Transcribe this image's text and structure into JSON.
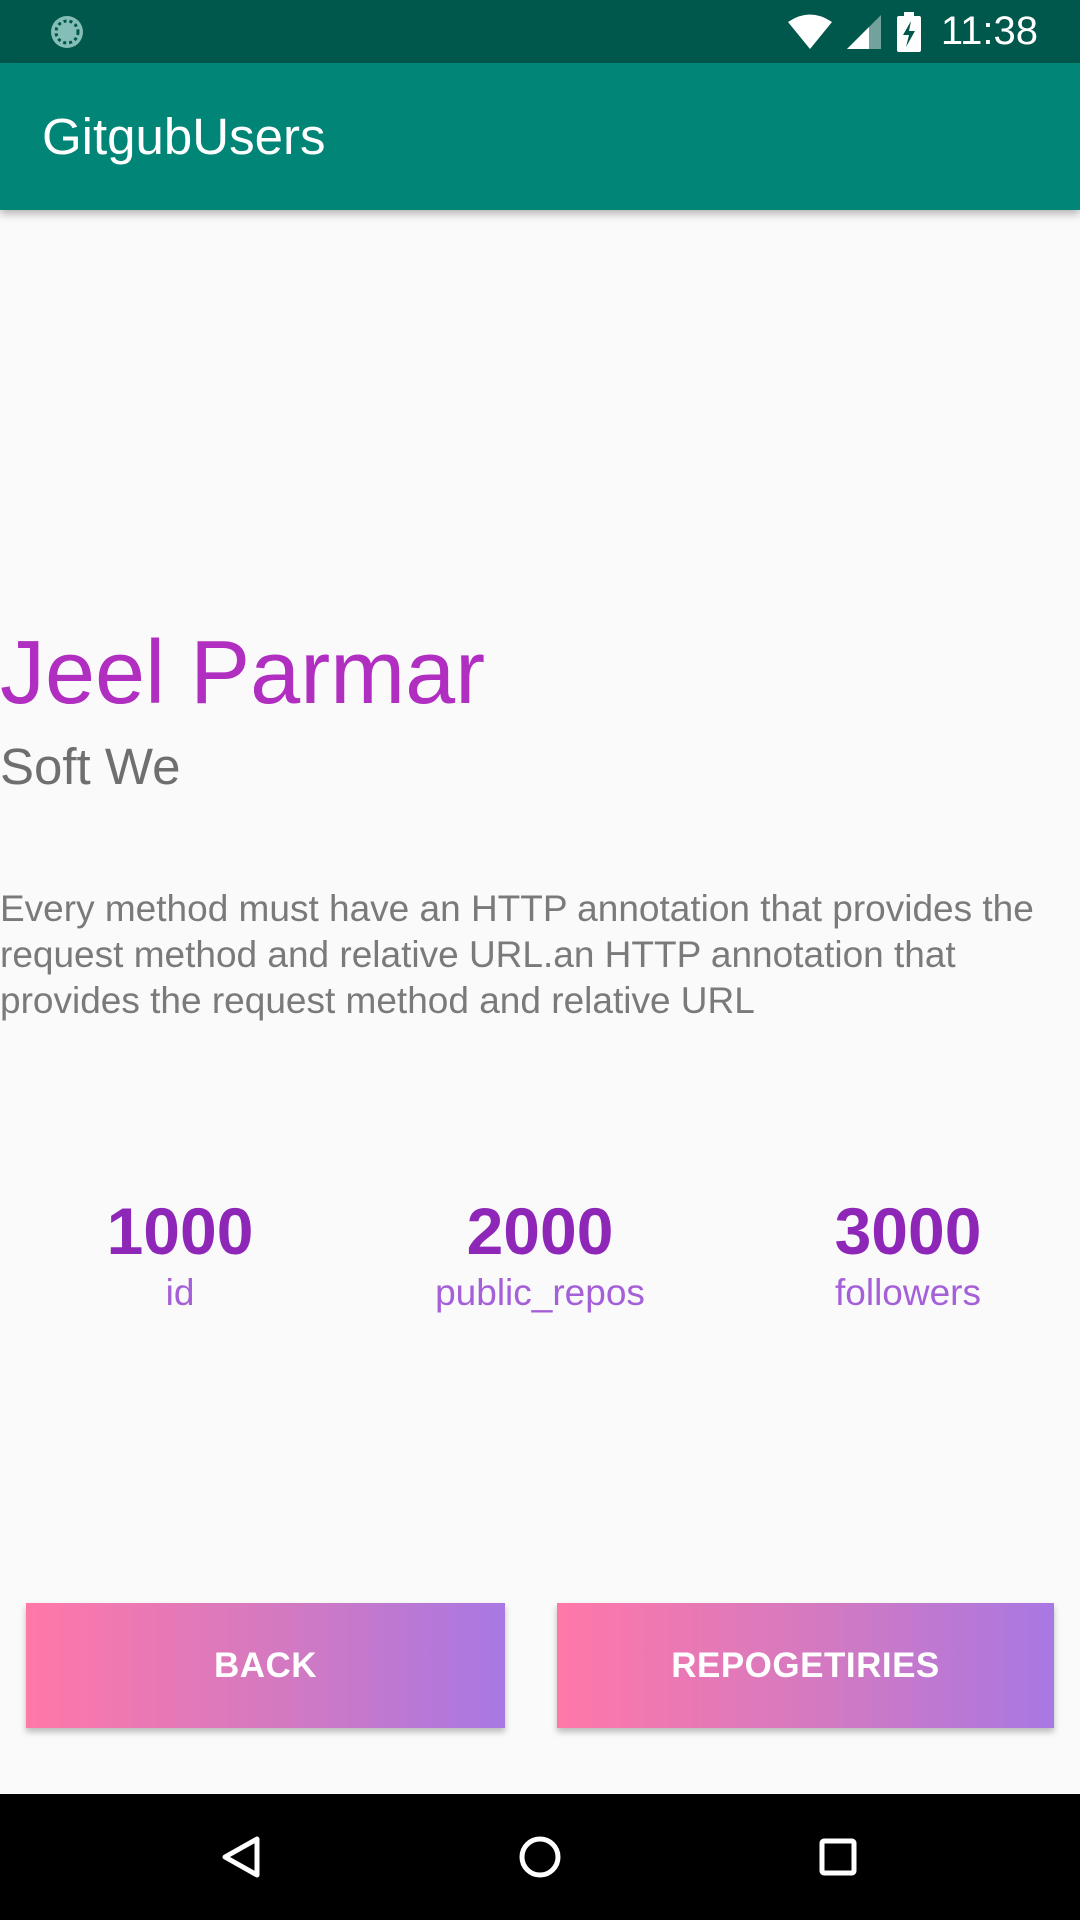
{
  "status_bar": {
    "time": "11:38",
    "icons": [
      "sync-icon",
      "wifi-icon",
      "signal-icon",
      "battery-charging-icon"
    ]
  },
  "app_bar": {
    "title": "GitgubUsers"
  },
  "profile": {
    "name": "Jeel Parmar",
    "company": "Soft We",
    "bio": "Every method must have an HTTP annotation that provides the request method and relative URL.an HTTP annotation that provides the request method and relative URL"
  },
  "stats": [
    {
      "value": "1000",
      "label": "id"
    },
    {
      "value": "2000",
      "label": "public_repos"
    },
    {
      "value": "3000",
      "label": "followers"
    }
  ],
  "buttons": {
    "back": "BACK",
    "repositories": "REPOGETIRIES"
  },
  "nav_bar": {
    "icons": [
      "back-triangle-icon",
      "home-circle-icon",
      "recents-square-icon"
    ]
  },
  "colors": {
    "status_bar": "#00574b",
    "app_bar": "#008577",
    "name": "#b02ec0",
    "stat_value": "#8e27b8",
    "stat_label": "#a560d8",
    "button_gradient_start": "#ff78a8",
    "button_gradient_end": "#a878e3"
  }
}
